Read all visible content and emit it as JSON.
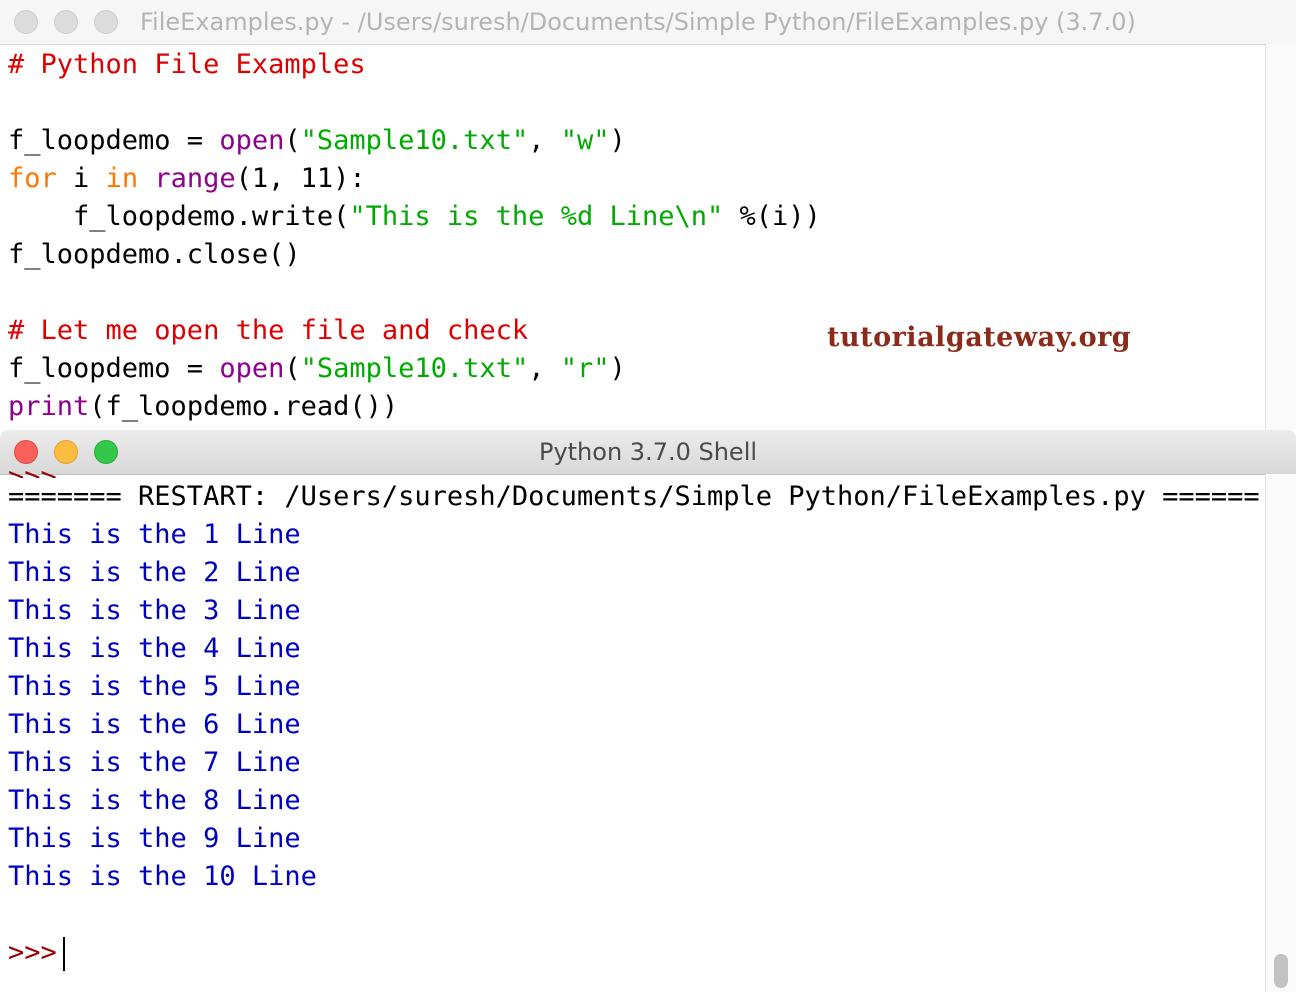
{
  "editor": {
    "title": "FileExamples.py - /Users/suresh/Documents/Simple Python/FileExamples.py (3.7.0)",
    "code_lines": [
      [
        {
          "t": "# Python File Examples",
          "c": "cm"
        }
      ],
      [],
      [
        {
          "t": "f_loopdemo = "
        },
        {
          "t": "open",
          "c": "bi"
        },
        {
          "t": "("
        },
        {
          "t": "\"Sample10.txt\"",
          "c": "str"
        },
        {
          "t": ", "
        },
        {
          "t": "\"w\"",
          "c": "str"
        },
        {
          "t": ")"
        }
      ],
      [
        {
          "t": "for",
          "c": "kw"
        },
        {
          "t": " i "
        },
        {
          "t": "in",
          "c": "kw"
        },
        {
          "t": " "
        },
        {
          "t": "range",
          "c": "bi"
        },
        {
          "t": "(1, 11):"
        }
      ],
      [
        {
          "t": "    f_loopdemo.write("
        },
        {
          "t": "\"This is the %d Line\\n\"",
          "c": "str"
        },
        {
          "t": " %(i))"
        }
      ],
      [
        {
          "t": "f_loopdemo.close()"
        }
      ],
      [],
      [
        {
          "t": "# Let me open the file and check",
          "c": "cm"
        }
      ],
      [
        {
          "t": "f_loopdemo = "
        },
        {
          "t": "open",
          "c": "bi"
        },
        {
          "t": "("
        },
        {
          "t": "\"Sample10.txt\"",
          "c": "str"
        },
        {
          "t": ", "
        },
        {
          "t": "\"r\"",
          "c": "str"
        },
        {
          "t": ")"
        }
      ],
      [
        {
          "t": "print",
          "c": "bi"
        },
        {
          "t": "(f_loopdemo.read())"
        }
      ]
    ],
    "watermark": "tutorialgateway.org"
  },
  "shell": {
    "title": "Python 3.7.0 Shell",
    "partial_prompt": ">>>",
    "restart_line": "======= RESTART: /Users/suresh/Documents/Simple Python/FileExamples.py =======",
    "output_lines": [
      "This is the 1 Line",
      "This is the 2 Line",
      "This is the 3 Line",
      "This is the 4 Line",
      "This is the 5 Line",
      "This is the 6 Line",
      "This is the 7 Line",
      "This is the 8 Line",
      "This is the 9 Line",
      "This is the 10 Line"
    ],
    "prompt": ">>>"
  },
  "colors": {
    "keyword": "#ff7700",
    "builtin": "#900090",
    "string": "#00aa00",
    "comment": "#dd0000",
    "output": "#0000c0",
    "prompt": "#990000",
    "watermark": "#8b2b1b"
  },
  "icons": [
    "close-icon",
    "minimize-icon",
    "zoom-icon"
  ]
}
